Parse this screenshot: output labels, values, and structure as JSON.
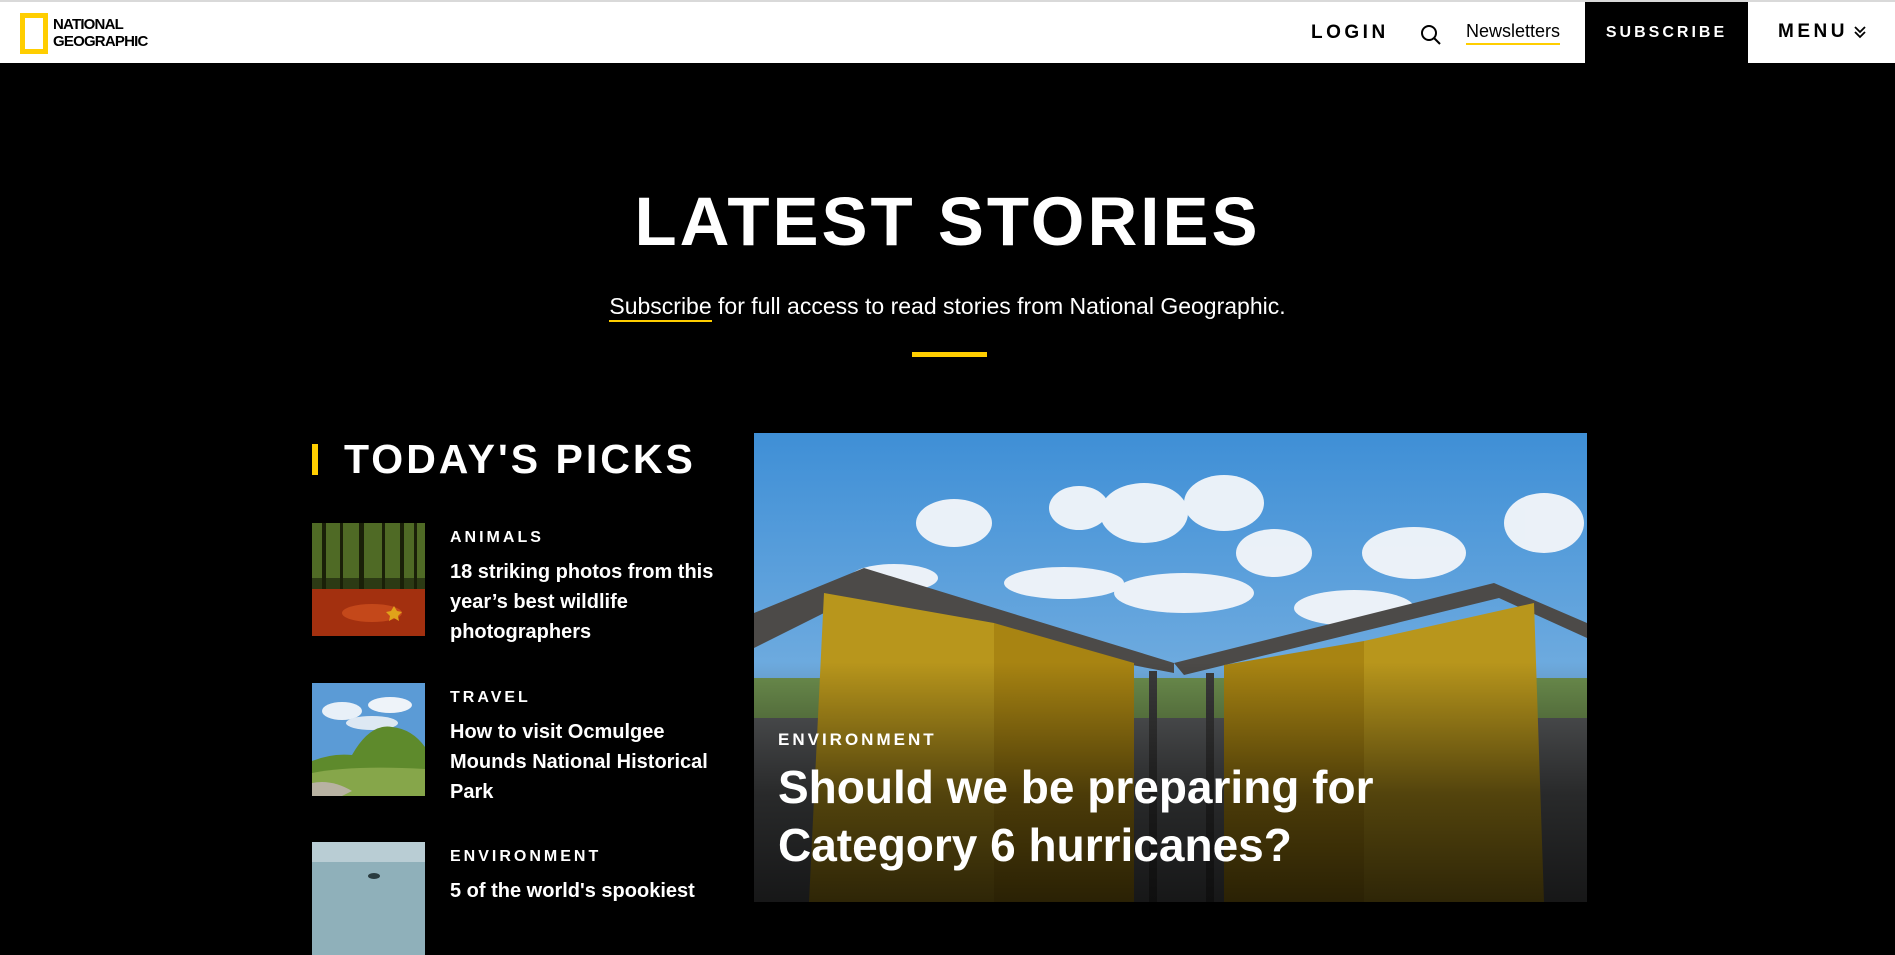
{
  "header": {
    "logo_line1": "NATIONAL",
    "logo_line2": "GEOGRAPHIC",
    "login": "LOGIN",
    "newsletters": "Newsletters",
    "subscribe": "SUBSCRIBE",
    "menu": "MENU"
  },
  "hero": {
    "title": "LATEST STORIES",
    "subscribe_link": "Subscribe",
    "subtitle_rest": " for full access to read stories from National Geographic."
  },
  "picks": {
    "title": "TODAY'S PICKS",
    "items": [
      {
        "category": "ANIMALS",
        "title": "18 striking photos from this year’s best wildlife photographers"
      },
      {
        "category": "TRAVEL",
        "title": "How to visit Ocmulgee Mounds National Historical Park"
      },
      {
        "category": "ENVIRONMENT",
        "title": "5 of the world's spookiest"
      }
    ]
  },
  "feature": {
    "category": "ENVIRONMENT",
    "title": "Should we be preparing for Category 6 hurricanes?"
  },
  "colors": {
    "accent": "#ffce00",
    "background": "#000000",
    "header": "#ffffff"
  }
}
